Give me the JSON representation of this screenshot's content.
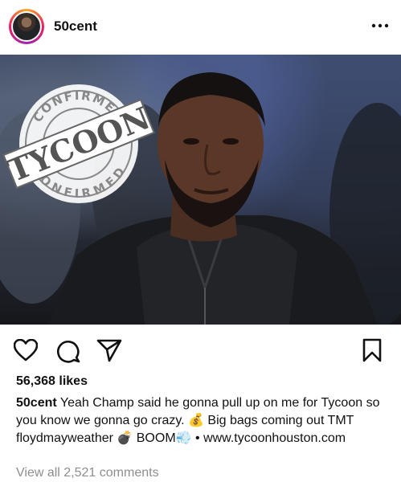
{
  "post": {
    "username": "50cent",
    "stamp": {
      "top_text": "CONFIRMED",
      "main_text": "TYCOON",
      "bottom_text": "CONFIRMED"
    },
    "likes": "56,368 likes",
    "caption_user": "50cent",
    "caption_text": "Yeah Champ said he gonna pull up on me for Tycoon so you know we gonna go crazy. 💰 Big bags coming out TMT floydmayweather 💣 BOOM💨 • www.tycoonhouston.com",
    "view_comments": "View all 2,521 comments"
  },
  "icons": {
    "more": "more-options-icon",
    "like": "heart-icon",
    "comment": "comment-icon",
    "share": "send-icon",
    "save": "bookmark-icon"
  }
}
